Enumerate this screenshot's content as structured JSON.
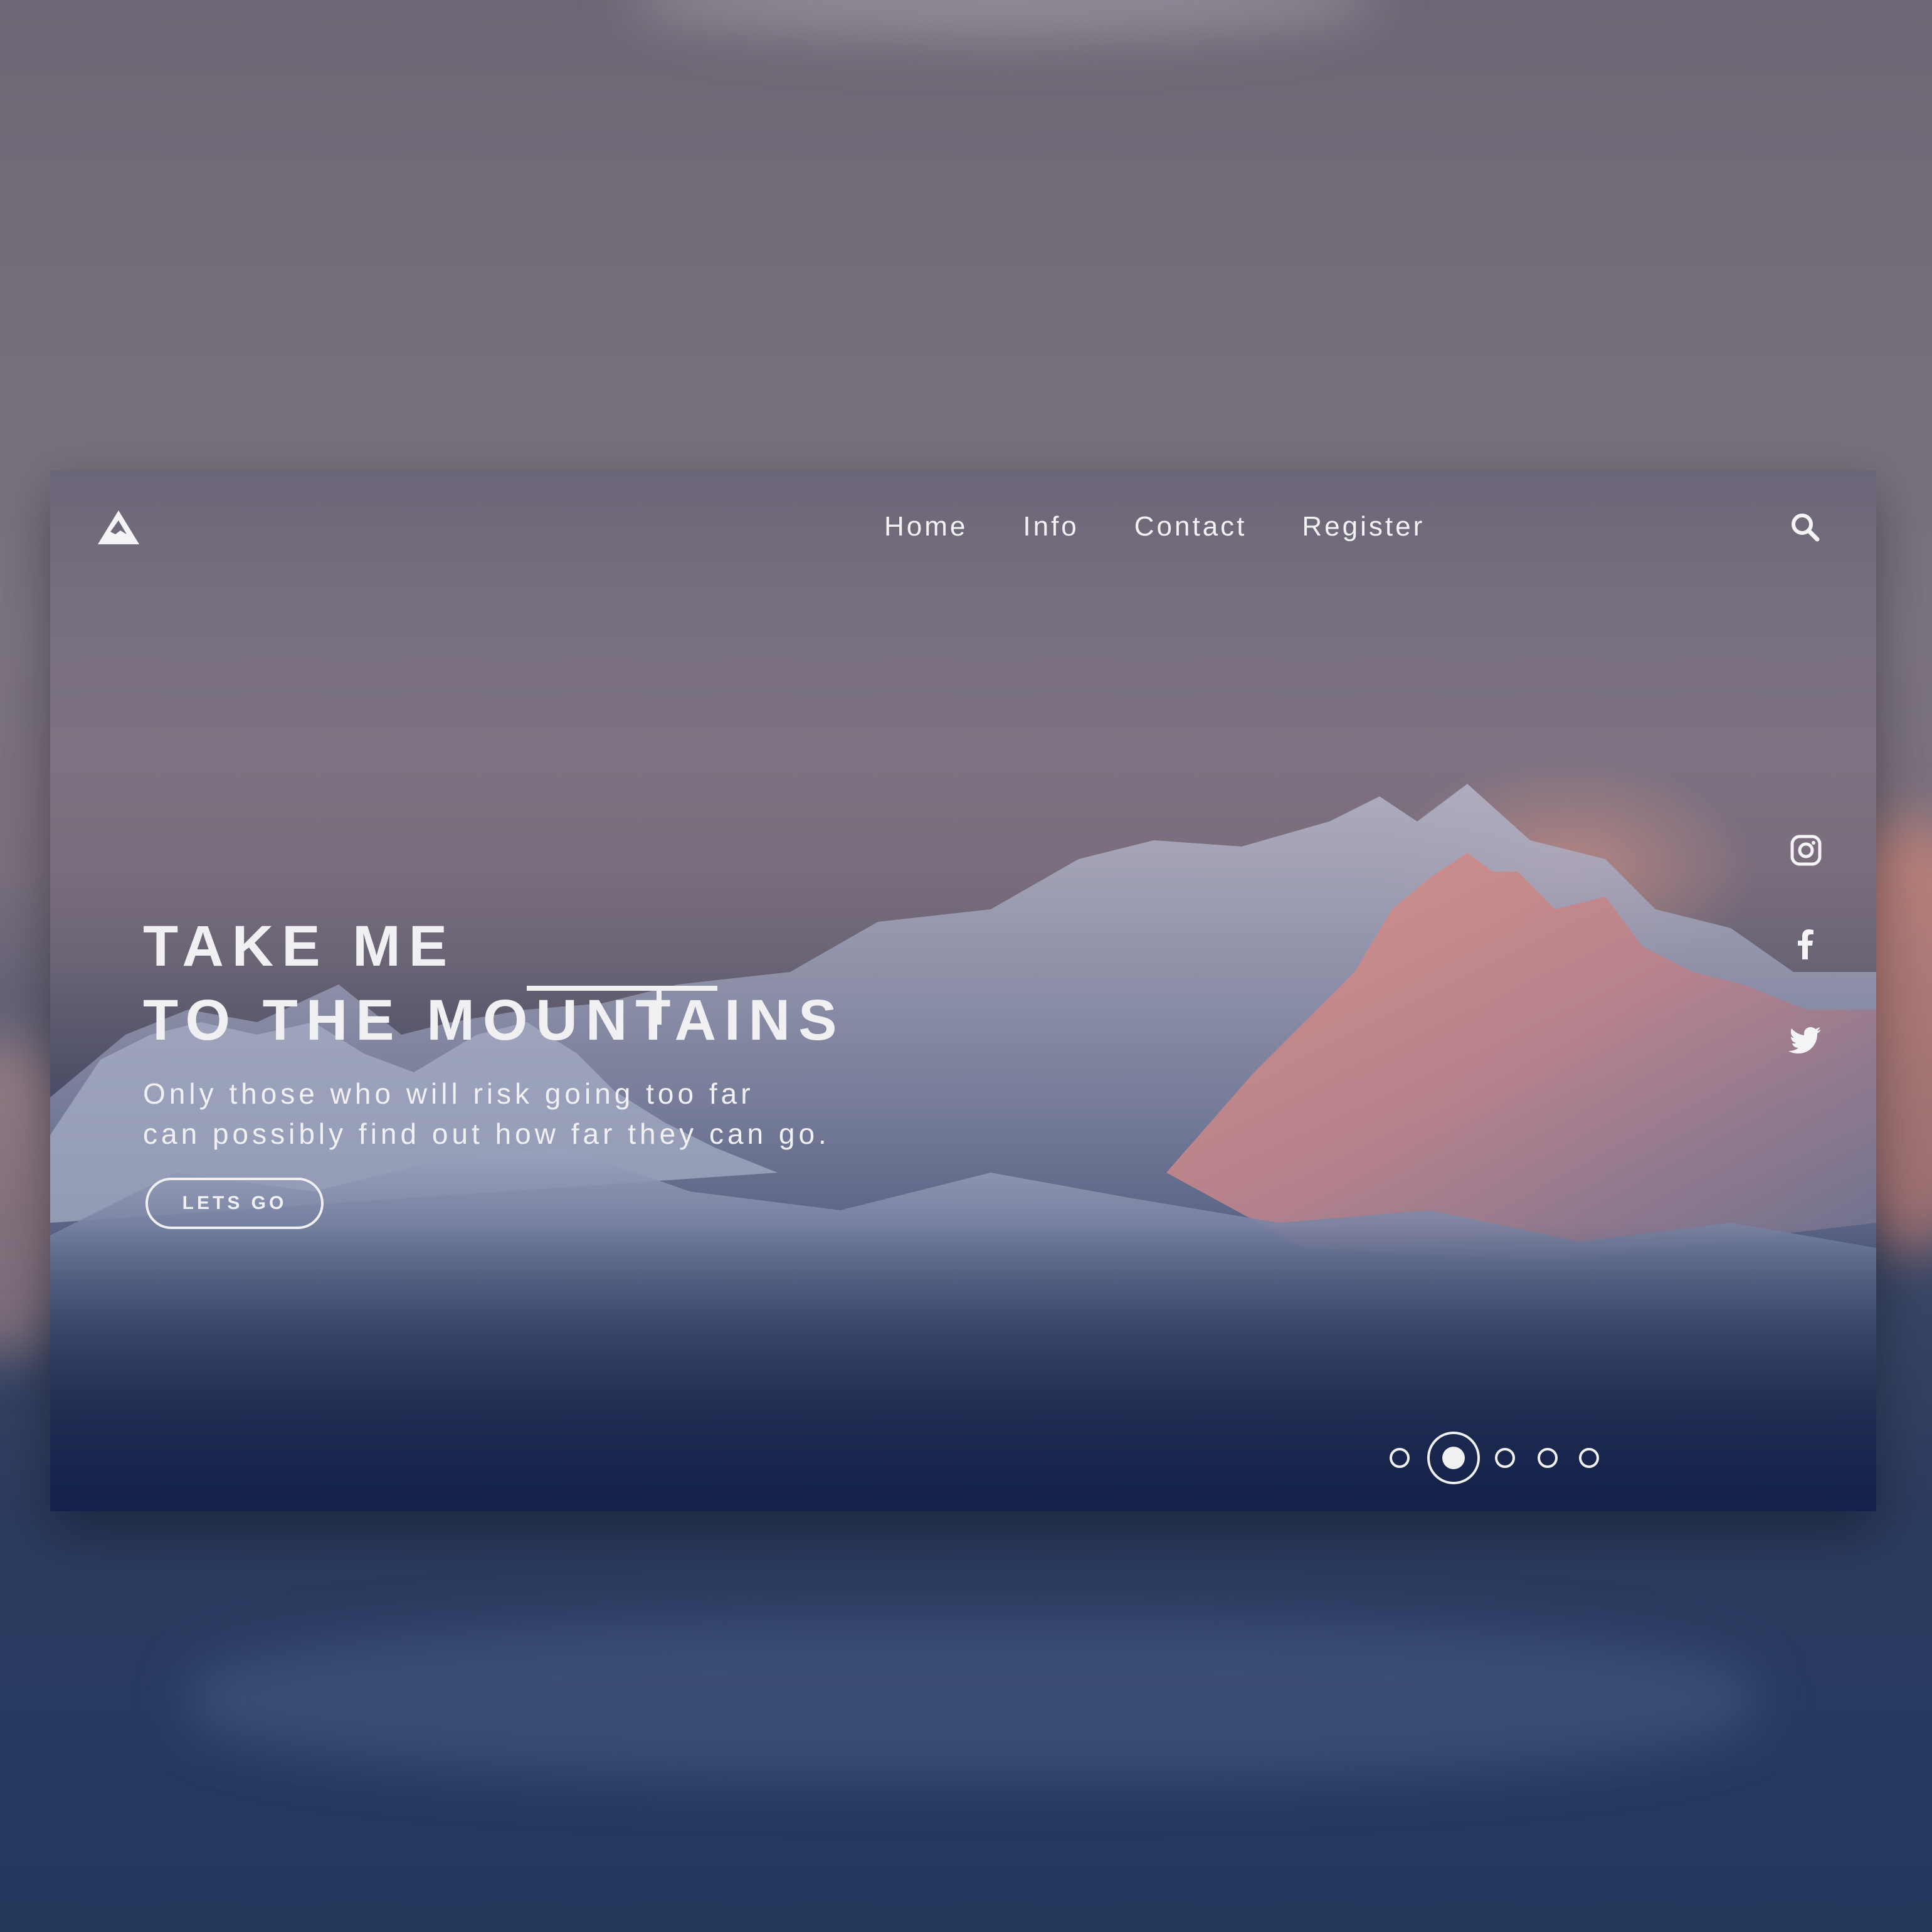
{
  "brand": {
    "logo_icon": "mountain-icon"
  },
  "nav": {
    "items": [
      {
        "label": "Home"
      },
      {
        "label": "Info"
      },
      {
        "label": "Contact"
      },
      {
        "label": "Register"
      }
    ],
    "search_icon": "search-icon"
  },
  "hero": {
    "headline_line1": "TAKE ME",
    "headline_line2": "TO THE MOUNTAINS",
    "tagline_line1": "Only those who will risk going too far",
    "tagline_line2": "can possibly find out how far they can go.",
    "cta_label": "LETS GO"
  },
  "social": {
    "icons": [
      "instagram-icon",
      "facebook-icon",
      "twitter-icon"
    ]
  },
  "carousel": {
    "total_slides": 5,
    "active_slide": 2
  },
  "colors": {
    "text": "#f0eff2",
    "sky": "#7a6f7d",
    "alpenglow": "#d98a7e",
    "snow": "#c9cfdf",
    "deep_blue": "#17264b"
  }
}
